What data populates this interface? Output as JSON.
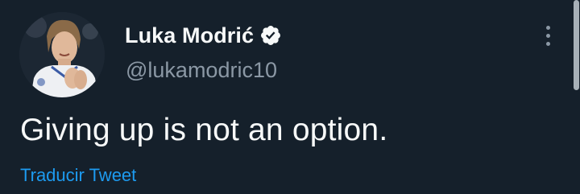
{
  "tweet": {
    "display_name": "Luka Modrić",
    "handle": "@lukamodric10",
    "text": "Giving up is not an option.",
    "translate_label": "Traducir Tweet",
    "verified": true
  },
  "icons": {
    "verified": "verified-badge-icon",
    "more": "more-options-icon"
  },
  "colors": {
    "background": "#15202b",
    "primary_text": "#f7f9f9",
    "secondary_text": "#8b98a5",
    "link": "#1d9bf0"
  }
}
